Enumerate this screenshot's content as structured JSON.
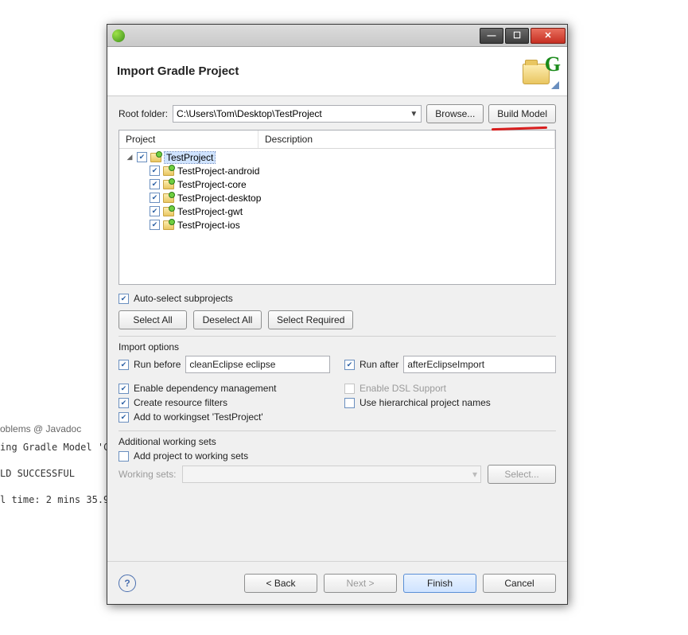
{
  "bg": {
    "tabs": "oblems    @ Javadoc    ",
    "line1": "ing Gradle Model 'C:\\Users",
    "line2": "LD SUCCESSFUL",
    "line3": "l time: 2 mins 35.9"
  },
  "header": {
    "title": "Import Gradle Project"
  },
  "root": {
    "label": "Root folder:",
    "path": "C:\\Users\\Tom\\Desktop\\TestProject",
    "browse": "Browse...",
    "build": "Build Model"
  },
  "tree": {
    "headers": {
      "project": "Project",
      "description": "Description"
    },
    "root": "TestProject",
    "children": [
      "TestProject-android",
      "TestProject-core",
      "TestProject-desktop",
      "TestProject-gwt",
      "TestProject-ios"
    ]
  },
  "auto_select": "Auto-select subprojects",
  "buttons": {
    "select_all": "Select All",
    "deselect_all": "Deselect All",
    "select_required": "Select Required"
  },
  "import_options": {
    "title": "Import options",
    "run_before_label": "Run before",
    "run_before_value": "cleanEclipse eclipse",
    "run_after_label": "Run after",
    "run_after_value": "afterEclipseImport",
    "enable_dep": "Enable dependency management",
    "enable_dsl": "Enable DSL Support",
    "create_filters": "Create resource filters",
    "hierarchical": "Use hierarchical project names",
    "add_workingset": "Add to workingset 'TestProject'"
  },
  "additional": {
    "title": "Additional working sets",
    "add_project": "Add project to working sets",
    "working_sets_label": "Working sets:",
    "select": "Select..."
  },
  "footer": {
    "back": "< Back",
    "next": "Next >",
    "finish": "Finish",
    "cancel": "Cancel"
  }
}
